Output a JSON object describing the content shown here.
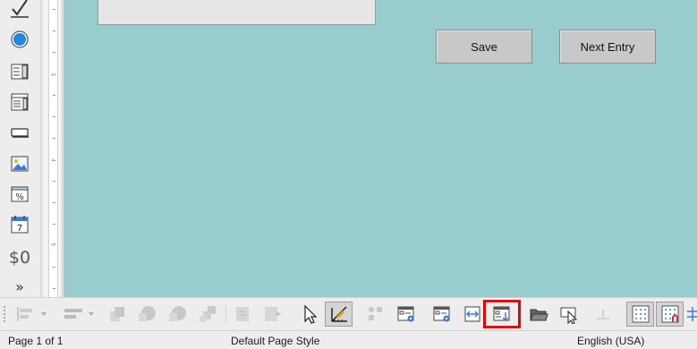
{
  "form": {
    "buttons": {
      "save_label": "Save",
      "next_entry_label": "Next Entry"
    },
    "background_color": "#99cccc"
  },
  "sidebar": {
    "items": [
      {
        "icon": "check-box-icon"
      },
      {
        "icon": "option-button-icon"
      },
      {
        "icon": "list-box-icon"
      },
      {
        "icon": "combo-box-icon"
      },
      {
        "icon": "push-button-icon"
      },
      {
        "icon": "image-button-icon"
      },
      {
        "icon": "formatted-field-icon"
      },
      {
        "icon": "date-field-icon",
        "label": "7"
      },
      {
        "icon": "currency-field-icon",
        "label": "$0"
      },
      {
        "icon": "more-controls-icon",
        "label": "»"
      }
    ]
  },
  "ruler": {
    "numbers": [
      "3",
      "4",
      "5"
    ]
  },
  "toolbar": {
    "items": [
      "align-left-icon",
      "align-objects-icon",
      "bring-to-front-icon",
      "send-to-back-icon",
      "group-icon",
      "ungroup-icon",
      "enter-group-icon",
      "exit-group-icon",
      "select-icon",
      "design-mode-icon",
      "control-properties-icon",
      "form-properties-icon",
      "form-navigator-icon",
      "activation-order-icon",
      "add-field-icon",
      "open-in-design-mode-icon",
      "automatic-control-focus-icon",
      "position-and-size-icon",
      "display-grid-icon",
      "snap-to-grid-icon",
      "helplines-while-moving-icon"
    ],
    "highlighted": "add-field-icon",
    "highlight_color": "#e60000"
  },
  "statusbar": {
    "page": "Page 1 of 1",
    "page_style": "Default Page Style",
    "language": "English (USA)"
  }
}
